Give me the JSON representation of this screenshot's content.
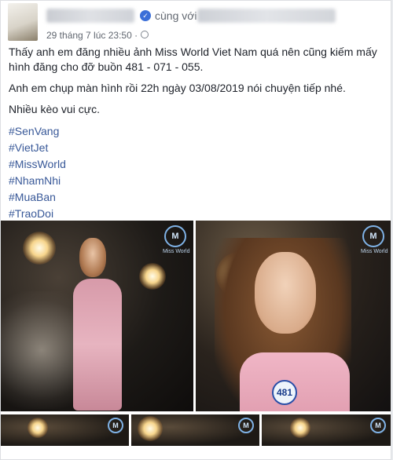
{
  "post": {
    "with_label": "cùng với",
    "timestamp": "29 tháng 7 lúc 23:50 ·",
    "paragraphs": [
      "Thấy anh em đăng nhiều ảnh Miss World Viet Nam quá nên cũng kiếm mấy hình đăng cho đỡ buồn 481 - 071 - 055.",
      "Anh em chụp màn hình rồi 22h ngày 03/08/2019 nói chuyện tiếp nhé.",
      "Nhiều kèo vui cực."
    ],
    "hashtags": [
      "#SenVang",
      "#VietJet",
      "#MissWorld",
      "#NhamNhi",
      "#MuaBan",
      "#TraoDoi"
    ]
  },
  "photos": {
    "logo_mark": "M",
    "logo_text": "Miss World",
    "badge_number": "481"
  },
  "colors": {
    "link": "#385898",
    "text": "#1d2129",
    "meta": "#616770"
  },
  "icons": [
    "verified-icon",
    "globe-icon"
  ]
}
